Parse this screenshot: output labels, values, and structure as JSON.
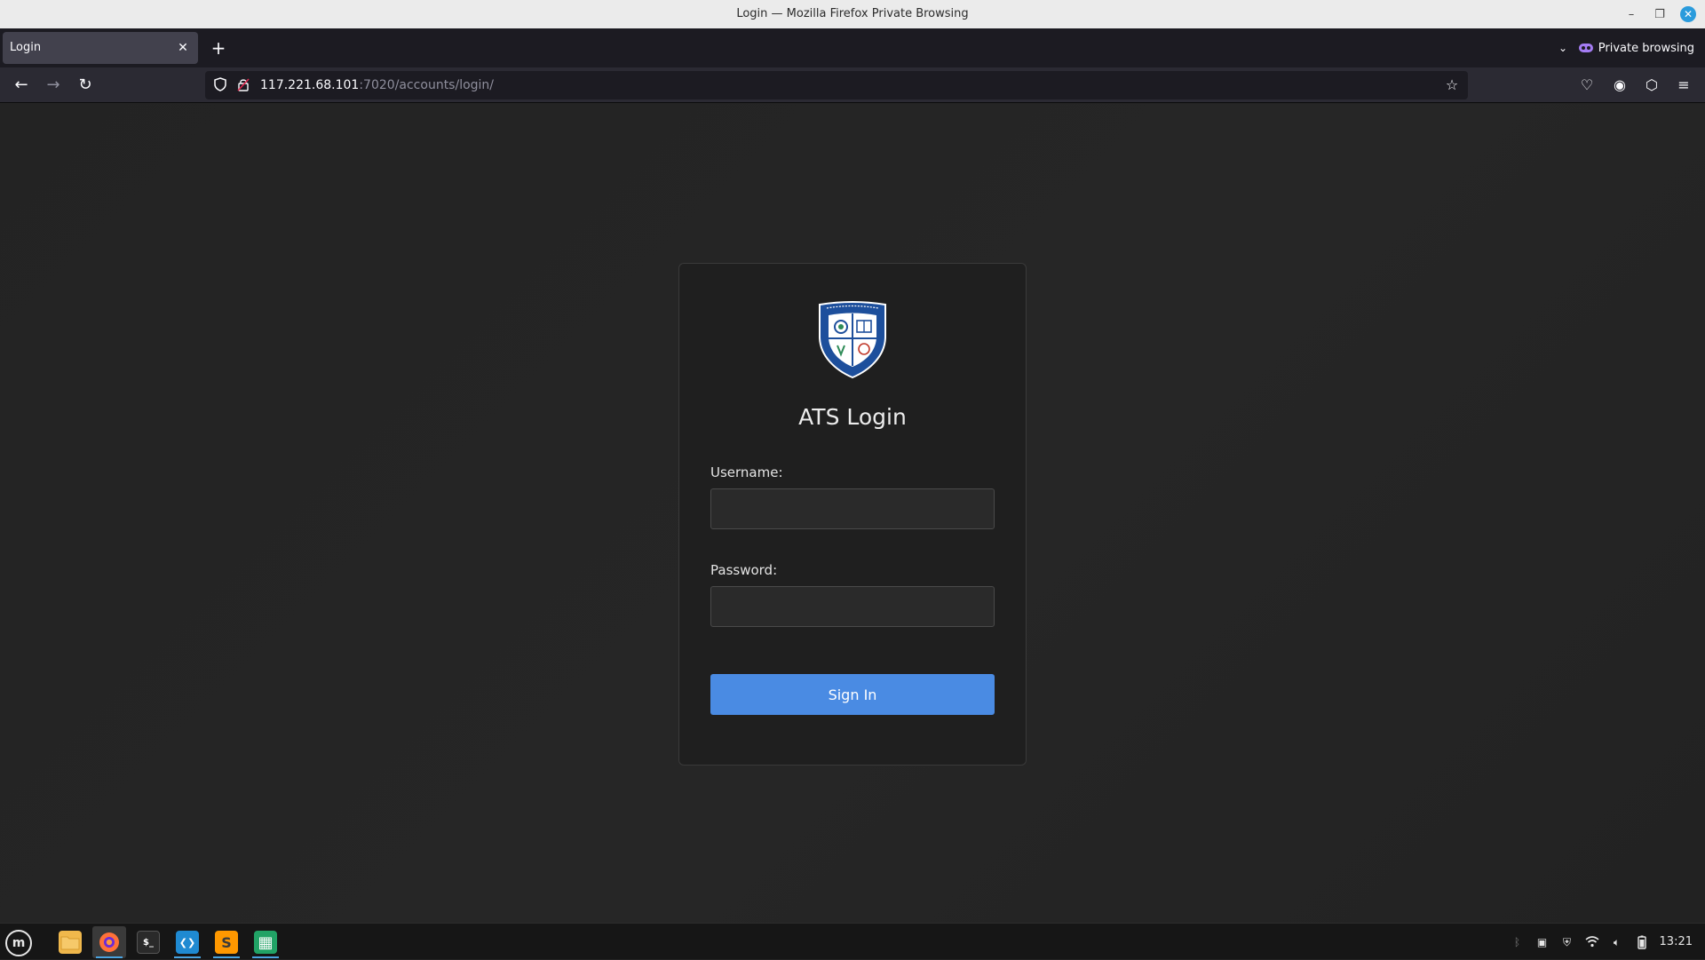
{
  "window": {
    "title": "Login — Mozilla Firefox Private Browsing",
    "minimize_glyph": "–",
    "restore_glyph": "❐",
    "close_glyph": "✕"
  },
  "tabs": [
    {
      "label": "Login",
      "close_glyph": "✕"
    }
  ],
  "tabstrip": {
    "new_tab_glyph": "+",
    "list_all_glyph": "⌄",
    "private_label": "Private browsing"
  },
  "nav": {
    "back_glyph": "←",
    "forward_glyph": "→",
    "reload_glyph": "↻",
    "url_host": "117.221.68.101",
    "url_rest": ":7020/accounts/login/",
    "bookmark_glyph": "☆",
    "pocket_glyph": "♡",
    "account_glyph": "◉",
    "extensions_glyph": "⬡",
    "menu_glyph": "≡"
  },
  "login": {
    "title": "ATS Login",
    "username_label": "Username:",
    "username_value": "",
    "password_label": "Password:",
    "password_value": "",
    "submit_label": "Sign In"
  },
  "taskbar": {
    "menu_glyph": "m",
    "apps": [
      {
        "name": "files",
        "glyph": ""
      },
      {
        "name": "firefox",
        "glyph": ""
      },
      {
        "name": "terminal",
        "glyph": "$_"
      },
      {
        "name": "vscode",
        "glyph": "❮❯"
      },
      {
        "name": "sublime-text",
        "glyph": "S"
      },
      {
        "name": "spreadsheet",
        "glyph": "▦"
      }
    ],
    "clock": "13:21"
  },
  "colors": {
    "accent": "#4a8be3",
    "private_purple": "#a47cf3",
    "page_bg": "#232323",
    "card_bg": "#1f1f1f"
  }
}
